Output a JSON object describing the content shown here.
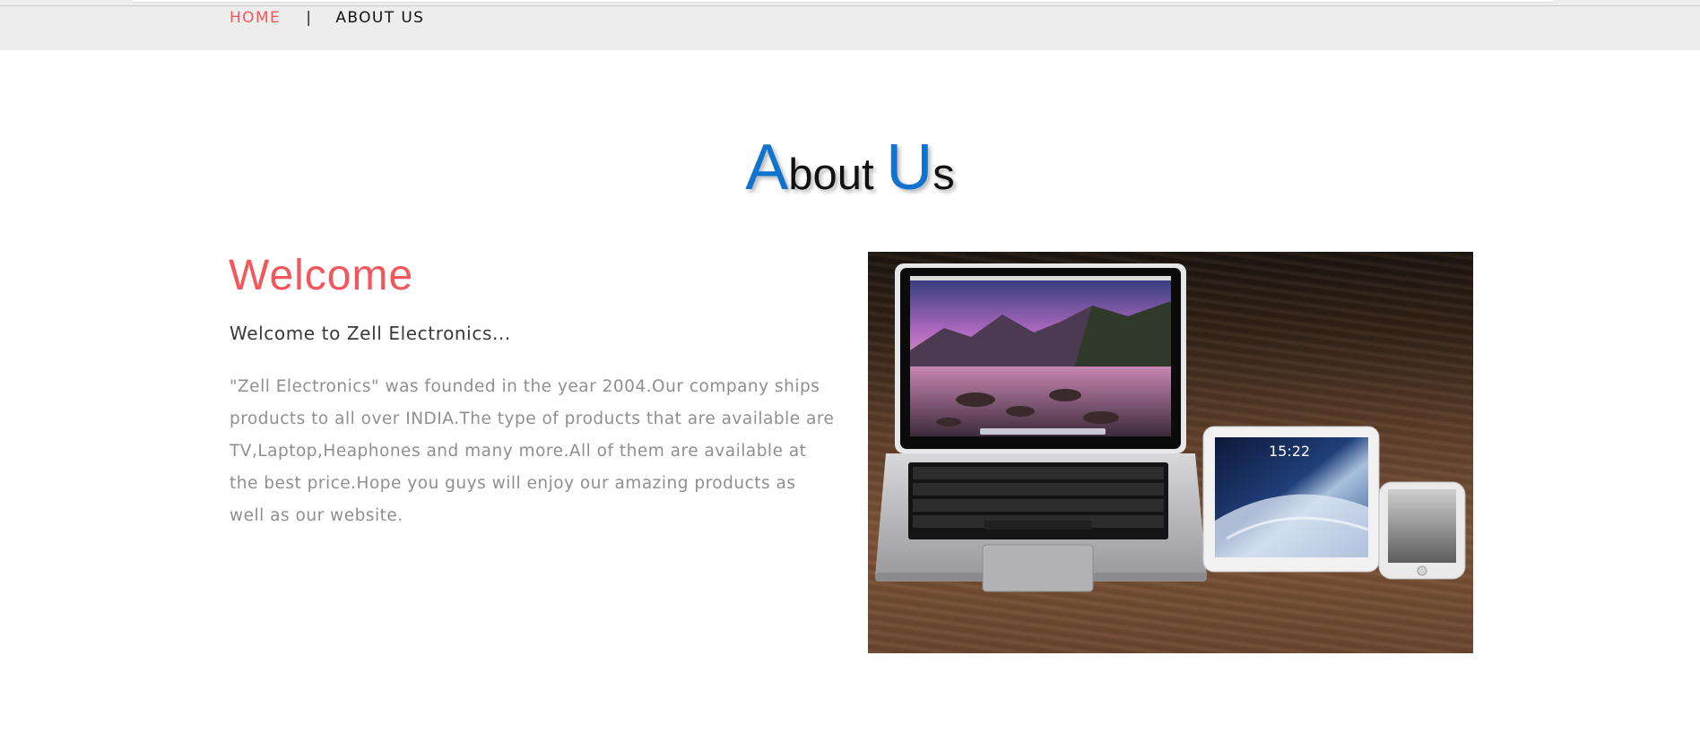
{
  "nav": {
    "home": "HOME",
    "separator": "|",
    "about": "ABOUT US"
  },
  "heading": {
    "cap1": "A",
    "rest1": "bout ",
    "cap2": "U",
    "rest2": "s"
  },
  "welcome": {
    "title": "Welcome",
    "subtitle": "Welcome to Zell Electronics...",
    "body": "\"Zell Electronics\" was founded in the year 2004.Our company ships products to all over INDIA.The type of products that are available are TV,Laptop,Heaphones and many more.All of them are available at the best price.Hope you guys will enjoy our amazing products as well as our website."
  },
  "photo": {
    "clock": "15:22"
  },
  "colors": {
    "accent_red": "#f5565b",
    "accent_blue": "#1074cf",
    "nav_bar": "#ededed"
  }
}
